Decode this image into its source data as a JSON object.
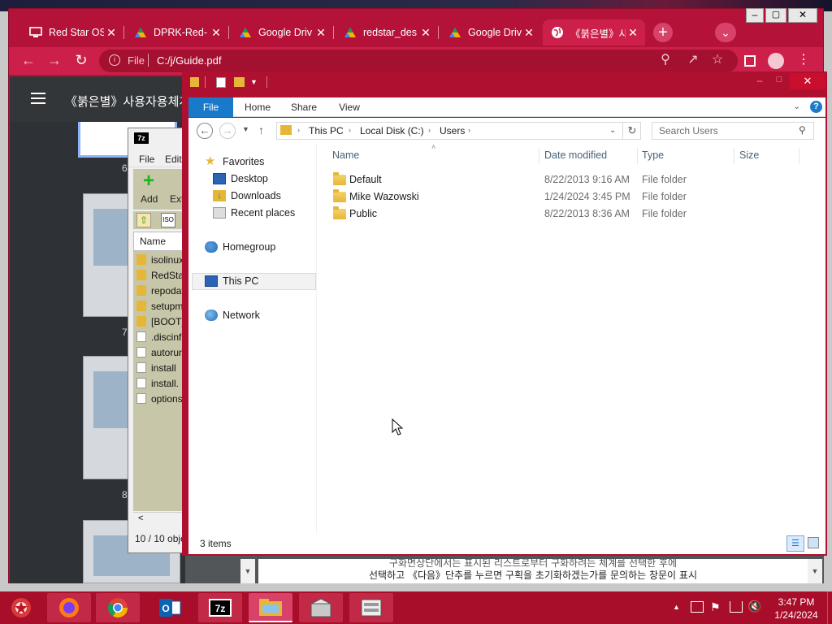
{
  "browser": {
    "tabs": [
      {
        "title": "Red Star OS",
        "icon": "monitor-icon"
      },
      {
        "title": "DPRK-Red-",
        "icon": "google-drive-icon"
      },
      {
        "title": "Google Driv",
        "icon": "google-drive-icon"
      },
      {
        "title": "redstar_des",
        "icon": "google-drive-icon"
      },
      {
        "title": "Google Driv",
        "icon": "google-drive-icon"
      },
      {
        "title": "《붉은별》사",
        "icon": "globe-icon"
      }
    ],
    "address_scheme": "File",
    "address_path": "C:/j/Guide.pdf",
    "pdf_title": "《붉은별》사용자용체계",
    "pdf_page_numbers": [
      "6",
      "7",
      "8"
    ],
    "pdf_bottom_line1": "구화면상단에서는 표시된 리스트로부터 구화하려는 체계를 선택한 후에",
    "pdf_bottom_line2": "선택하고 《다음》단추를 누르면 구획을 초기화하겠는가를 문의하는 창문이 표시"
  },
  "sevenzip": {
    "menu": [
      "File",
      "Edit"
    ],
    "toolbar": [
      "Add",
      "Ext"
    ],
    "column": "Name",
    "files": [
      "isolinux",
      "RedStar",
      "repodata",
      "setupm",
      "[BOOT]",
      ".discinf",
      "autorun",
      "install",
      "install.",
      "options"
    ],
    "status": "10 / 10 obje"
  },
  "explorer": {
    "ribbon_tabs": [
      "File",
      "Home",
      "Share",
      "View"
    ],
    "breadcrumb": [
      "This PC",
      "Local Disk (C:)",
      "Users"
    ],
    "search_placeholder": "Search Users",
    "nav": {
      "favorites": "Favorites",
      "favorites_items": [
        "Desktop",
        "Downloads",
        "Recent places"
      ],
      "homegroup": "Homegroup",
      "this_pc": "This PC",
      "network": "Network"
    },
    "columns": {
      "name": "Name",
      "date": "Date modified",
      "type": "Type",
      "size": "Size"
    },
    "rows": [
      {
        "name": "Default",
        "date": "8/22/2013 9:16 AM",
        "type": "File folder"
      },
      {
        "name": "Mike Wazowski",
        "date": "1/24/2024 3:45 PM",
        "type": "File folder"
      },
      {
        "name": "Public",
        "date": "8/22/2013 8:36 AM",
        "type": "File folder"
      }
    ],
    "status": "3 items"
  },
  "taskbar": {
    "time": "3:47 PM",
    "date": "1/24/2024",
    "apps": [
      "firefox-icon",
      "chrome-icon",
      "outlook-icon",
      "7zip-icon",
      "file-explorer-icon",
      "installer-icon",
      "control-panel-icon"
    ]
  }
}
